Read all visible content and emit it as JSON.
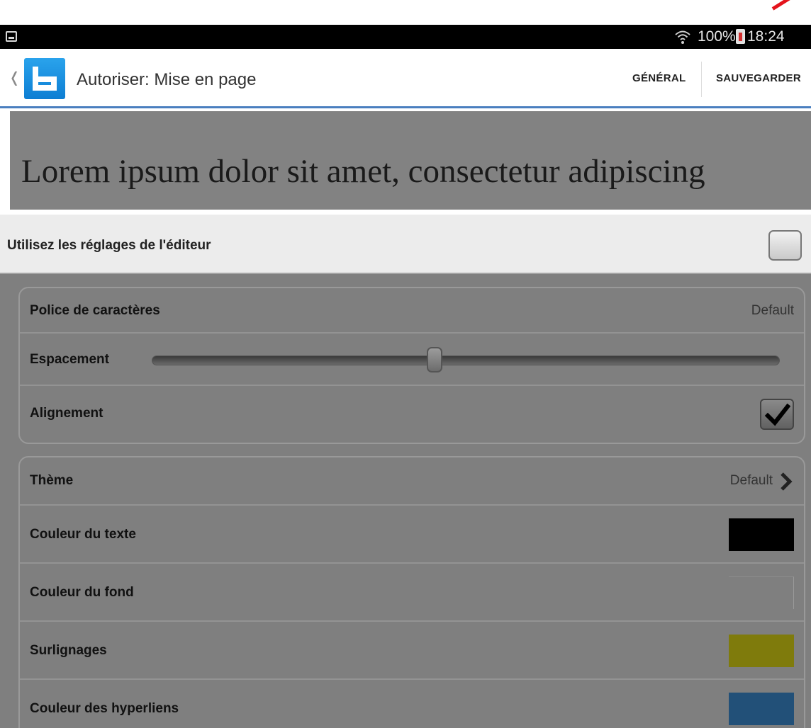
{
  "status_bar": {
    "battery_percent": "100%",
    "time": "18:24",
    "icons": [
      "screenshot-icon",
      "wifi-icon",
      "battery-icon"
    ]
  },
  "app_bar": {
    "title": "Autoriser: Mise en page",
    "actions": {
      "general": "GÉNÉRAL",
      "save": "SAUVEGARDER"
    },
    "accent_color": "#4a7fbf"
  },
  "preview": {
    "text": "Lorem ipsum dolor sit amet, consectetur adipiscing"
  },
  "editor_settings": {
    "label": "Utilisez les réglages de l'éditeur",
    "checked": false
  },
  "layout_group": {
    "font": {
      "label": "Police de caractères",
      "value": "Default"
    },
    "spacing": {
      "label": "Espacement",
      "level": 0.45
    },
    "alignment": {
      "label": "Alignement",
      "checked": true
    }
  },
  "theme_group": {
    "theme": {
      "label": "Thème",
      "value": "Default"
    },
    "text_color": {
      "label": "Couleur du texte",
      "color": "#000000"
    },
    "background_color": {
      "label": "Couleur du fond",
      "color": "#7f7f7f"
    },
    "highlights": {
      "label": "Surlignages",
      "color": "#7f7b0c"
    },
    "link_color": {
      "label": "Couleur des hyperliens",
      "color": "#225078"
    }
  }
}
